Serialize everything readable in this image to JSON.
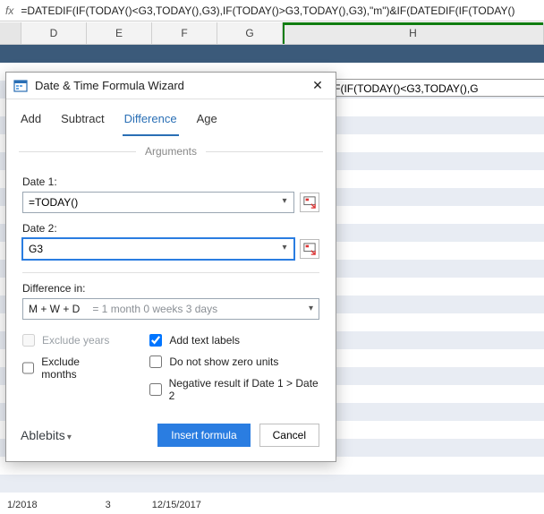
{
  "formula_bar": "=DATEDIF(IF(TODAY()<G3,TODAY(),G3),IF(TODAY()>G3,TODAY(),G3),\"m\")&IF(DATEDIF(IF(TODAY()",
  "columns": {
    "D": "D",
    "E": "E",
    "F": "F",
    "G": "G",
    "H": "H"
  },
  "cell_H3": "=DATEDIF(IF(TODAY()<G3,TODAY(),G",
  "bottom_cells": {
    "a": "1/2018",
    "b": "3",
    "c": "12/15/2017"
  },
  "dialog": {
    "title": "Date & Time Formula Wizard",
    "tabs": {
      "add": "Add",
      "subtract": "Subtract",
      "difference": "Difference",
      "age": "Age"
    },
    "arguments_label": "Arguments",
    "date1_label": "Date 1:",
    "date1_value": "=TODAY()",
    "date2_label": "Date 2:",
    "date2_value": "G3",
    "diff_label": "Difference in:",
    "diff_value": "M + W + D",
    "diff_hint": "= 1 month 0 weeks 3 days",
    "checks": {
      "exclude_years": "Exclude years",
      "exclude_months": "Exclude months",
      "add_text_labels": "Add text labels",
      "no_zero_units": "Do not show zero units",
      "neg_result": "Negative result if Date 1 > Date 2"
    },
    "brand": "Ablebits",
    "insert_btn": "Insert formula",
    "cancel_btn": "Cancel"
  }
}
